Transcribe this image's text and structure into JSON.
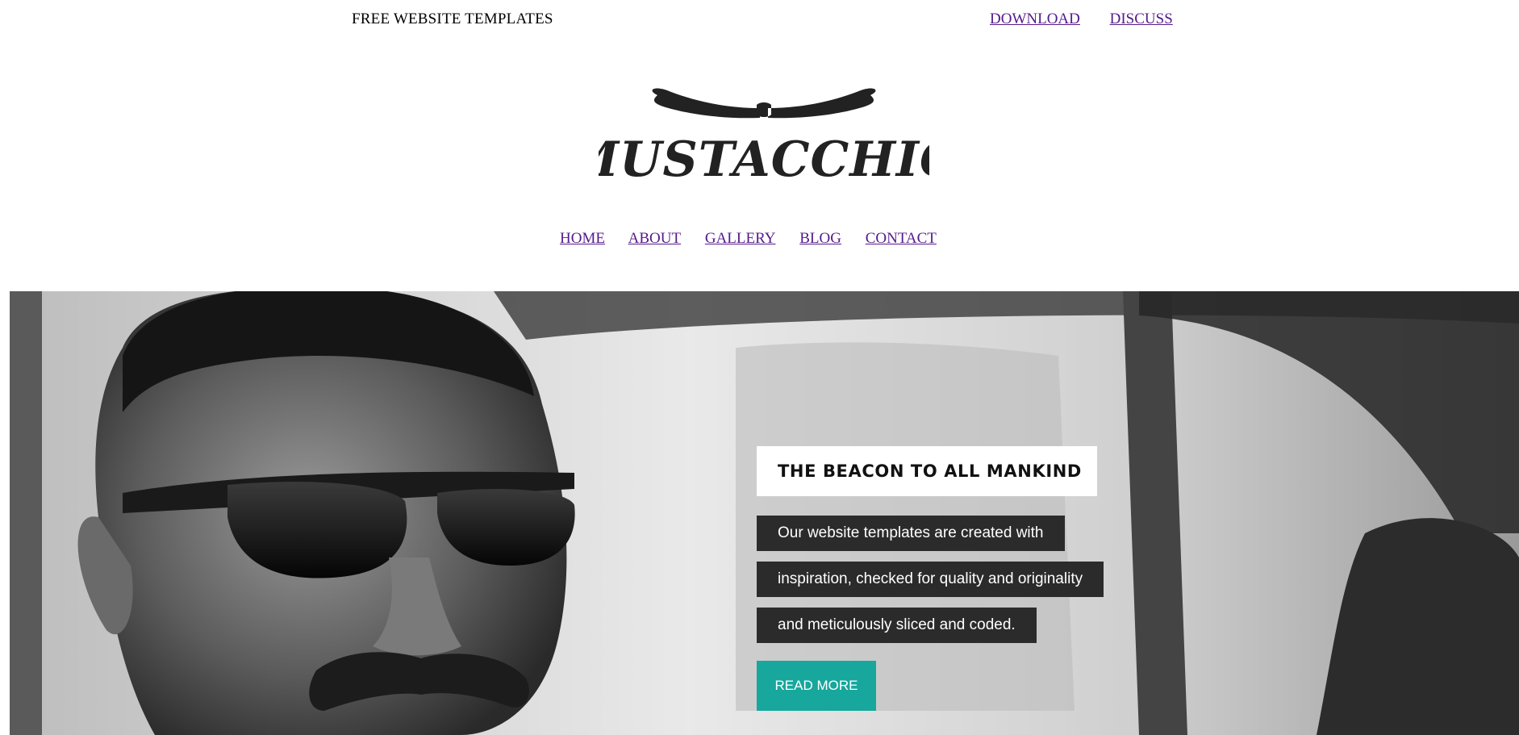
{
  "topbar": {
    "site_title": "FREE WEBSITE TEMPLATES",
    "links": [
      "DOWNLOAD",
      "DISCUSS"
    ]
  },
  "logo": {
    "text": "MUSTACCHIO"
  },
  "nav": {
    "items": [
      "HOME",
      "ABOUT",
      "GALLERY",
      "BLOG",
      "CONTACT"
    ]
  },
  "hero": {
    "heading": "THE BEACON TO ALL MANKIND",
    "lines": [
      "Our website templates are created with",
      "inspiration, checked for quality and originality",
      "and meticulously sliced and coded."
    ],
    "button_label": "READ MORE"
  },
  "colors": {
    "link": "#551a8b",
    "accent_button": "#17a79c",
    "text_box": "#2b2b2b"
  }
}
